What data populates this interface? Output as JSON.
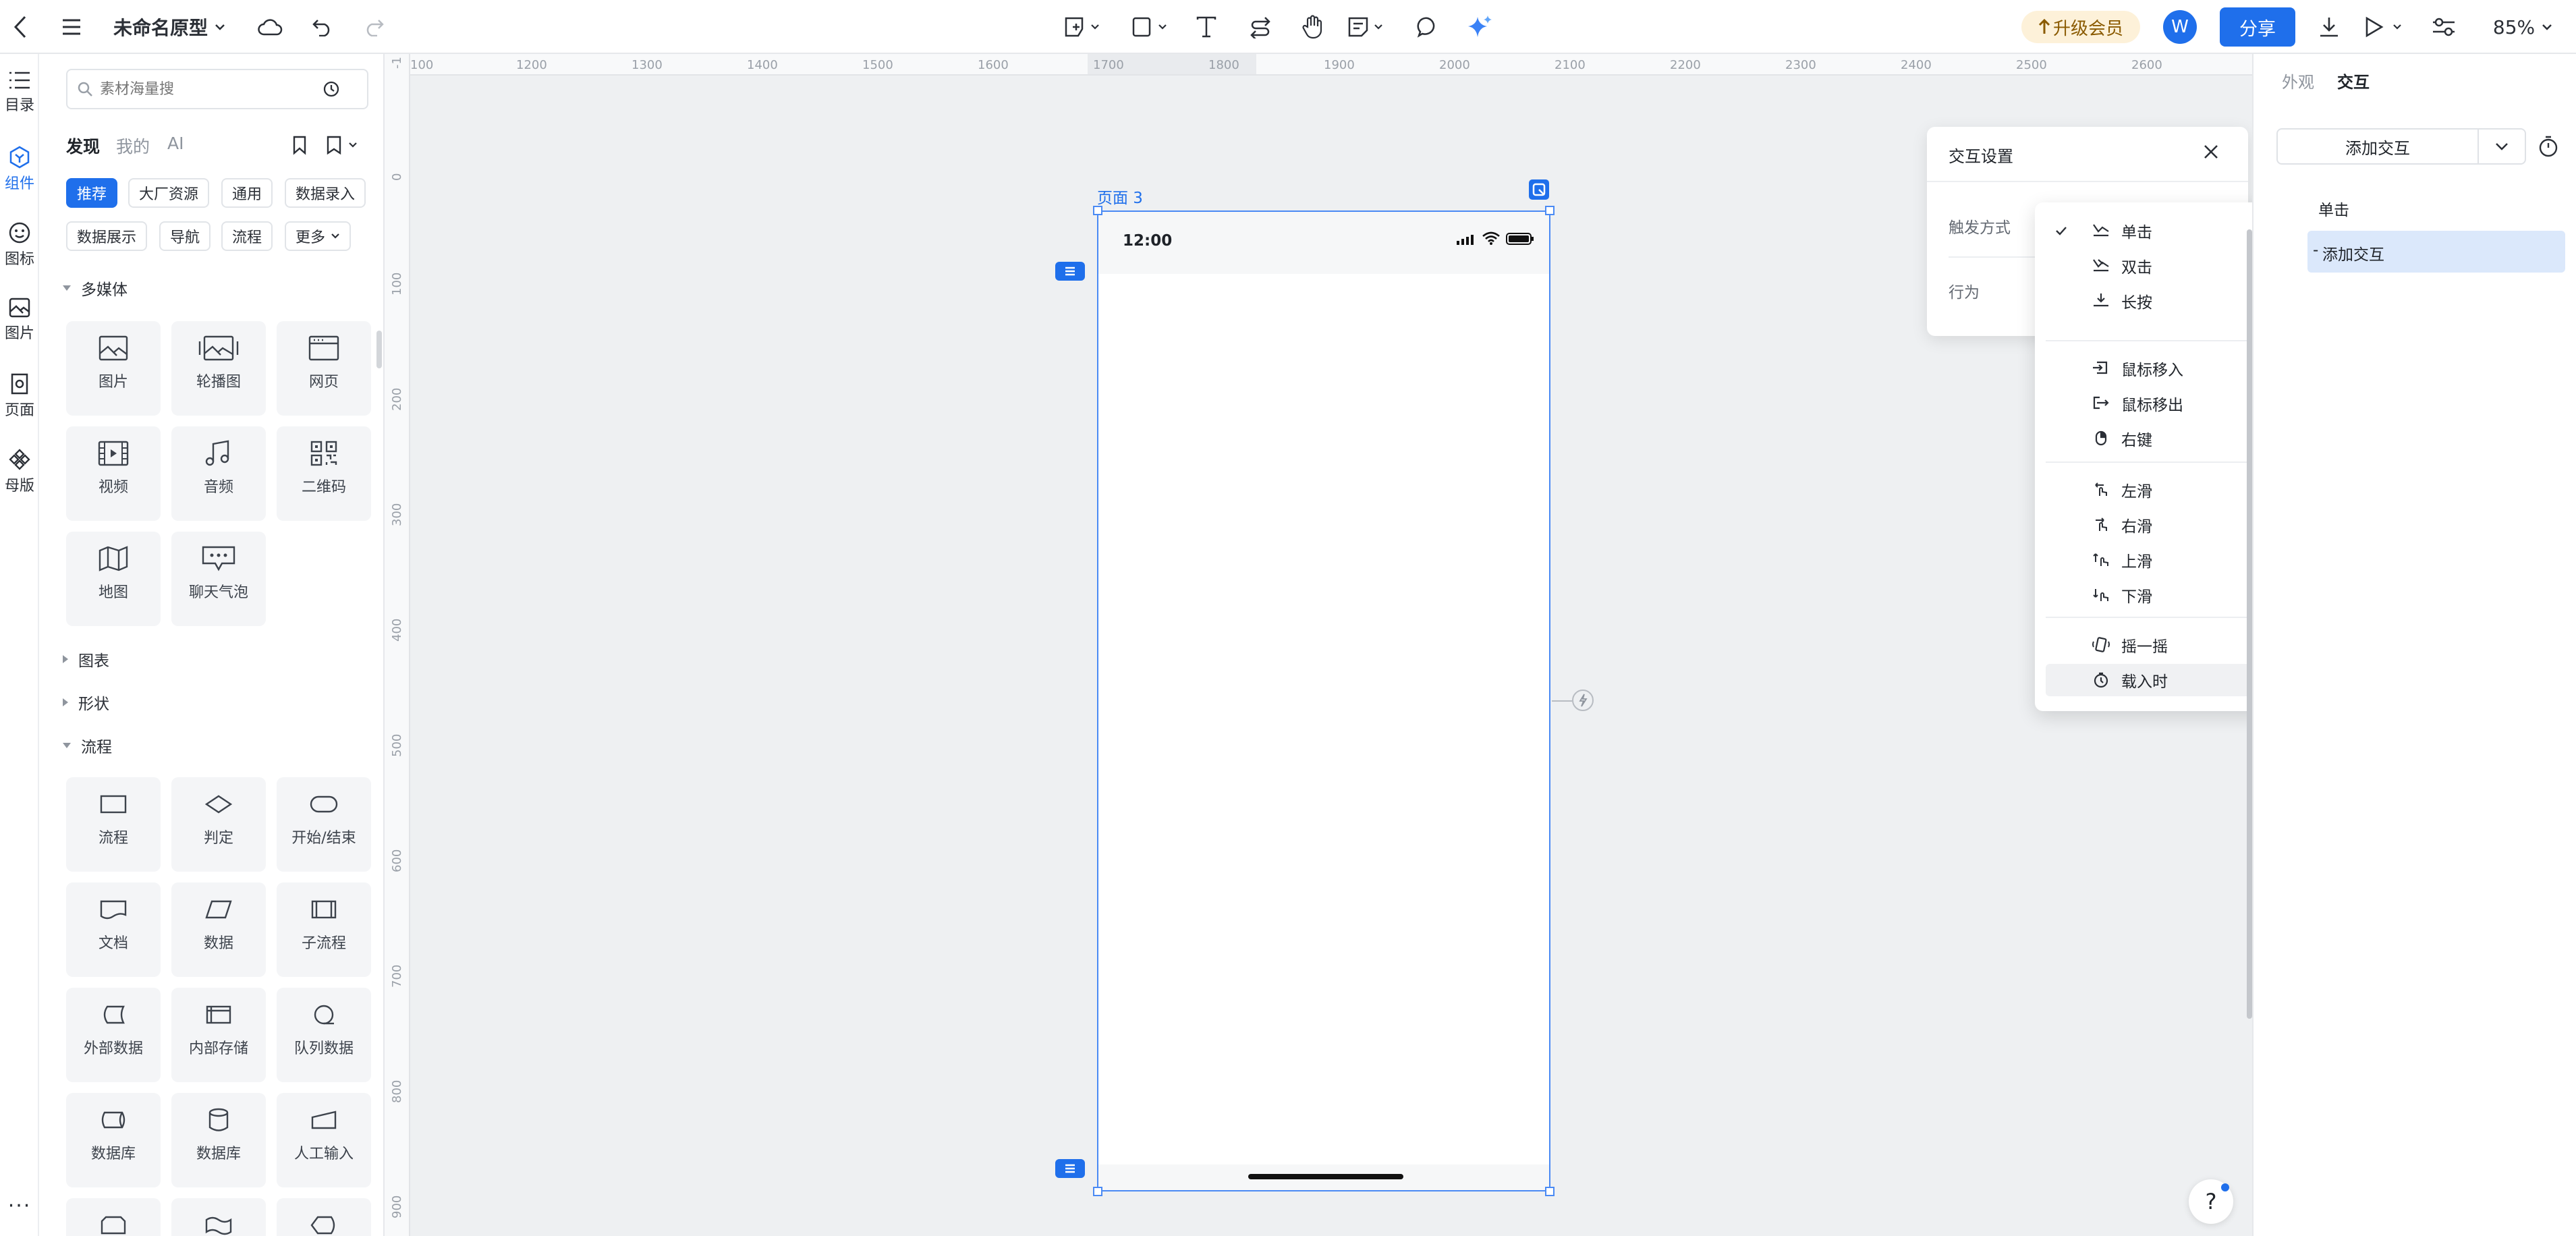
{
  "topbar": {
    "title": "未命名原型",
    "upgrade": "升级会员",
    "avatar": "W",
    "share": "分享",
    "zoom": "85%"
  },
  "rail": [
    {
      "label": "目录",
      "icon": "list-icon"
    },
    {
      "label": "组件",
      "icon": "component-icon"
    },
    {
      "label": "图标",
      "icon": "smiley-icon"
    },
    {
      "label": "图片",
      "icon": "image-icon"
    },
    {
      "label": "页面",
      "icon": "page-icon"
    },
    {
      "label": "母版",
      "icon": "master-icon"
    }
  ],
  "library": {
    "search_placeholder": "素材海量搜",
    "tabs": [
      "发现",
      "我的",
      "AI"
    ],
    "chips": [
      "推荐",
      "大厂资源",
      "通用",
      "数据录入",
      "数据展示",
      "导航",
      "流程",
      "更多"
    ],
    "sections": {
      "multimedia": "多媒体",
      "chart": "图表",
      "shape": "形状",
      "flow": "流程"
    },
    "media_tiles": [
      "图片",
      "轮播图",
      "网页",
      "视频",
      "音频",
      "二维码",
      "地图",
      "聊天气泡"
    ],
    "flow_tiles": [
      "流程",
      "判定",
      "开始/结束",
      "文档",
      "数据",
      "子流程",
      "外部数据",
      "内部存储",
      "队列数据",
      "数据库",
      "数据库",
      "人工输入"
    ]
  },
  "ruler": {
    "h": [
      "100",
      "1200",
      "1300",
      "1400",
      "1500",
      "1600",
      "1700",
      "1800",
      "1900",
      "2000",
      "2100",
      "2200",
      "2300",
      "2400",
      "2500",
      "2600"
    ],
    "v": [
      "-1",
      "0",
      "100",
      "200",
      "300",
      "400",
      "500",
      "600",
      "700",
      "800",
      "900"
    ]
  },
  "canvas": {
    "frame_label": "页面 3",
    "status_time": "12:00"
  },
  "interaction_dialog": {
    "title": "交互设置",
    "trigger_label": "触发方式",
    "action_label": "行为"
  },
  "trigger_menu": {
    "groups": [
      [
        "单击",
        "双击",
        "长按"
      ],
      [
        "鼠标移入",
        "鼠标移出",
        "右键"
      ],
      [
        "左滑",
        "右滑",
        "上滑",
        "下滑"
      ],
      [
        "摇一摇",
        "载入时"
      ]
    ],
    "checked": "单击",
    "hovered": "载入时"
  },
  "rpanel": {
    "tabs": [
      "外观",
      "交互"
    ],
    "add_button": "添加交互",
    "event": "单击",
    "add_action": "添加交互"
  },
  "help": "?"
}
